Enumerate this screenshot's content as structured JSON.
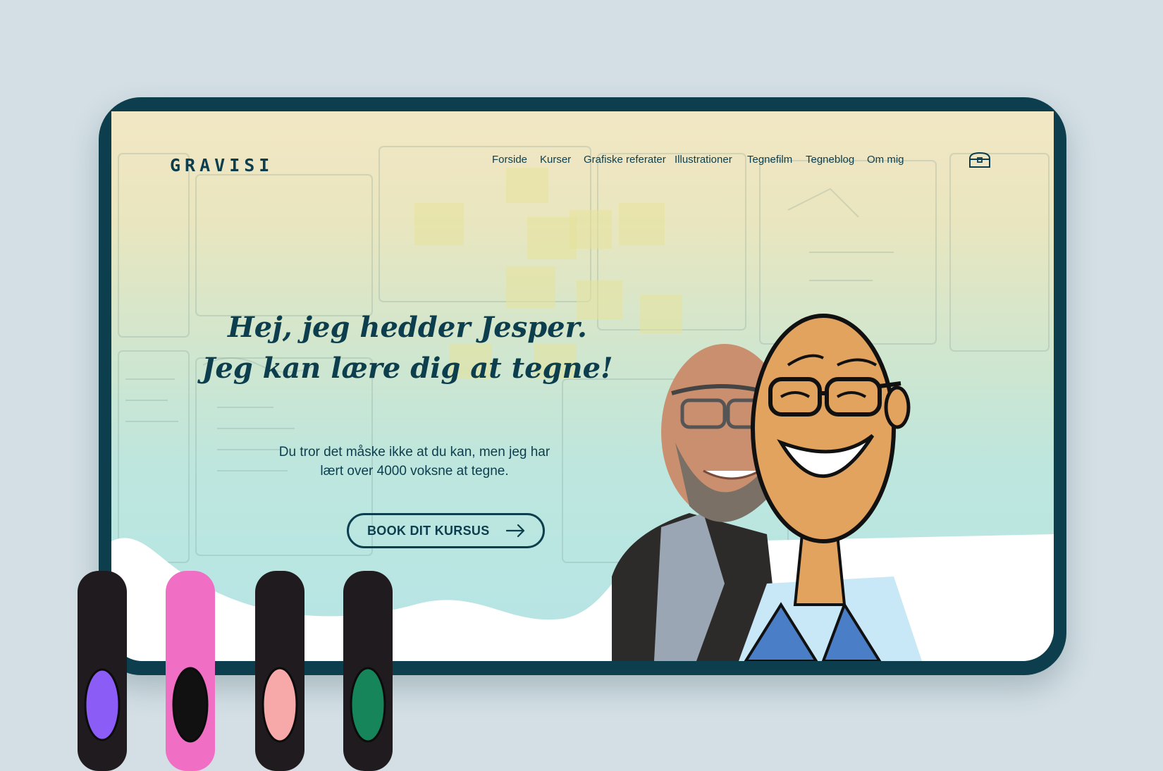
{
  "site": {
    "logo": "GRAVISI",
    "nav": [
      {
        "label": "Forside"
      },
      {
        "label": "Kurser"
      },
      {
        "label": "Grafiske referater"
      },
      {
        "label": "Illustrationer"
      },
      {
        "label": "Tegnefilm"
      },
      {
        "label": "Tegneblog"
      },
      {
        "label": "Om mig"
      }
    ],
    "cart_icon": "treasure-chest-icon"
  },
  "hero": {
    "headline_line1": "Hej, jeg hedder Jesper.",
    "headline_line2": "Jeg kan lære dig at tegne!",
    "subtext_line1": "Du tror det måske ikke at du kan, men jeg har",
    "subtext_line2": "lært over 4000 voksne at tegne.",
    "cta_label": "BOOK DIT KURSUS",
    "cta_icon": "arrow-right-icon"
  },
  "colors": {
    "brand": "#0d3e4d",
    "page_background": "#d3dfe5",
    "marker_caps": [
      "#8b5cf6",
      "#f472b6",
      "#f7a8a8",
      "#16855a"
    ]
  }
}
